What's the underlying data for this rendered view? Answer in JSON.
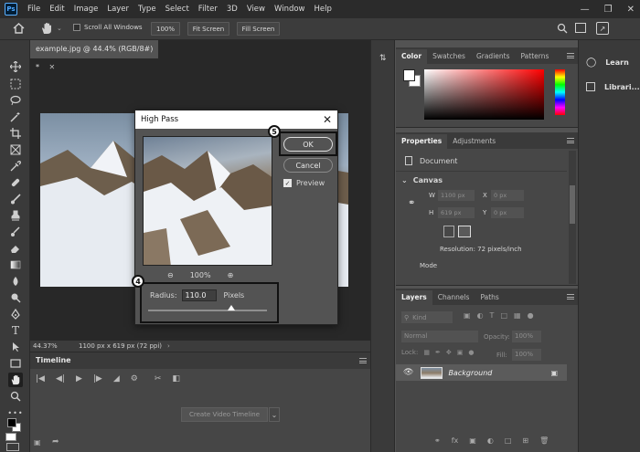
{
  "menu": [
    "File",
    "Edit",
    "Image",
    "Layer",
    "Type",
    "Select",
    "Filter",
    "3D",
    "View",
    "Window",
    "Help"
  ],
  "app_logo": "Ps",
  "options": {
    "scroll_all_windows": "Scroll All Windows",
    "zoom_value": "100%",
    "fit_screen": "Fit Screen",
    "fill_screen": "Fill Screen"
  },
  "document": {
    "tab_title": "example.jpg @ 44.4% (RGB/8#) *",
    "status_zoom": "44.37%",
    "status_info": "1100 px x 619 px (72 ppi)"
  },
  "timeline": {
    "title": "Timeline",
    "create_button": "Create Video Timeline"
  },
  "color_panel": {
    "tabs": [
      "Color",
      "Swatches",
      "Gradients",
      "Patterns"
    ],
    "hue_color": "#ff0000"
  },
  "properties_panel": {
    "tabs": [
      "Properties",
      "Adjustments"
    ],
    "document_label": "Document",
    "canvas_label": "Canvas",
    "w_label": "W",
    "w_value": "1100 px",
    "h_label": "H",
    "h_value": "619 px",
    "x_label": "X",
    "x_value": "0 px",
    "y_label": "Y",
    "y_value": "0 px",
    "resolution": "Resolution: 72 pixels/inch",
    "mode_label": "Mode"
  },
  "layers_panel": {
    "tabs": [
      "Layers",
      "Channels",
      "Paths"
    ],
    "kind_label": "Kind",
    "blend_mode": "Normal",
    "opacity_label": "Opacity:",
    "opacity_value": "100%",
    "lock_label": "Lock:",
    "fill_label": "Fill:",
    "fill_value": "100%",
    "layer_name": "Background"
  },
  "right_dock": {
    "learn": "Learn",
    "libraries": "Librari..."
  },
  "dialog": {
    "title": "High Pass",
    "ok": "OK",
    "cancel": "Cancel",
    "preview": "Preview",
    "zoom": "100%",
    "radius_label": "Radius:",
    "radius_value": "110.0",
    "unit": "Pixels",
    "slider_level": 0.7,
    "step_badge_ok": "5",
    "step_badge_radius": "4"
  }
}
